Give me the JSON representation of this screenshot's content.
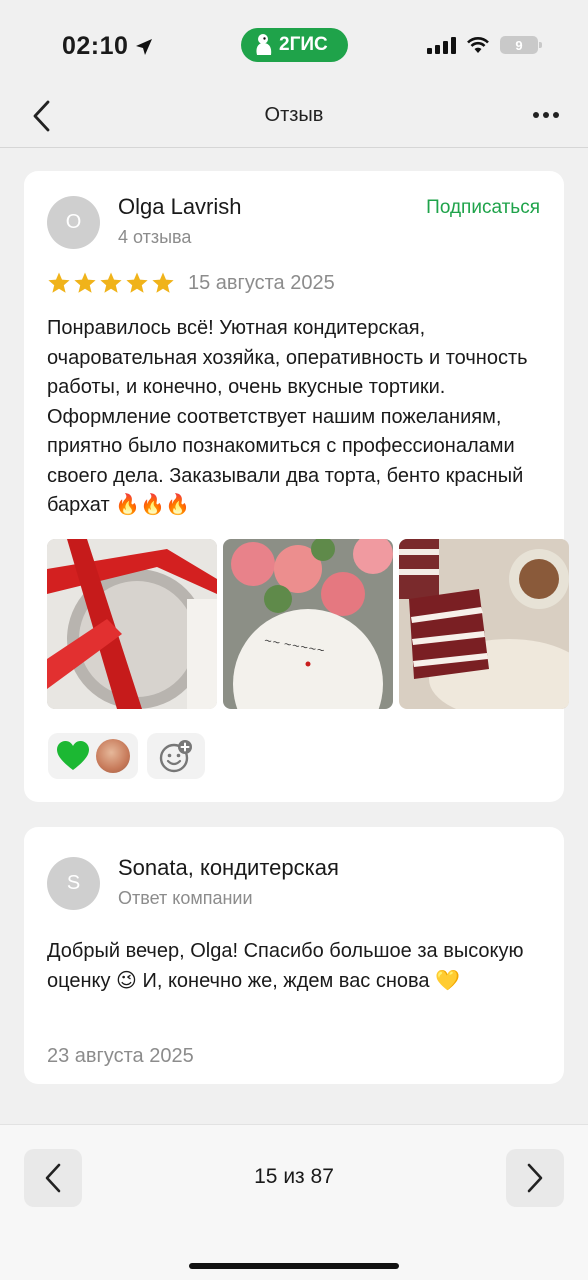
{
  "status_bar": {
    "time": "02:10",
    "app_badge": "2ГИС",
    "battery": "9"
  },
  "nav": {
    "title": "Отзыв"
  },
  "review": {
    "avatar_letter": "O",
    "author": "Olga Lavrish",
    "author_meta": "4 отзыва",
    "subscribe_label": "Подписаться",
    "rating": 5,
    "rating_max": 5,
    "date": "15 августа 2025",
    "text": "Понравилось всё! Уютная кондитерская, очаровательная хозяйка, оперативность и точность работы, и конечно, очень вкусные тортики. Оформление соответствует нашим пожеланиям, приятно было познакомиться с профессионалами своего дела. Заказывали два торта, бенто красный бархат 🔥🔥🔥",
    "photos": [
      "photo-cake-box",
      "photo-cake-flowers",
      "photo-red-velvet-slice"
    ],
    "reactions": [
      {
        "icon": "green-heart-icon"
      }
    ],
    "add_reaction_icon": "add-reaction-icon",
    "colors": {
      "accent": "#1fa34a",
      "star": "#f0b31a"
    }
  },
  "reply": {
    "avatar_letter": "S",
    "author": "Sonata, кондитерская",
    "author_meta": "Ответ компании",
    "text": "Добрый вечер, Olga! Спасибо большое за высокую оценку 😉 И, конечно же, ждем вас снова 💛",
    "date": "23 августа 2025"
  },
  "pager": {
    "label": "15 из 87"
  }
}
